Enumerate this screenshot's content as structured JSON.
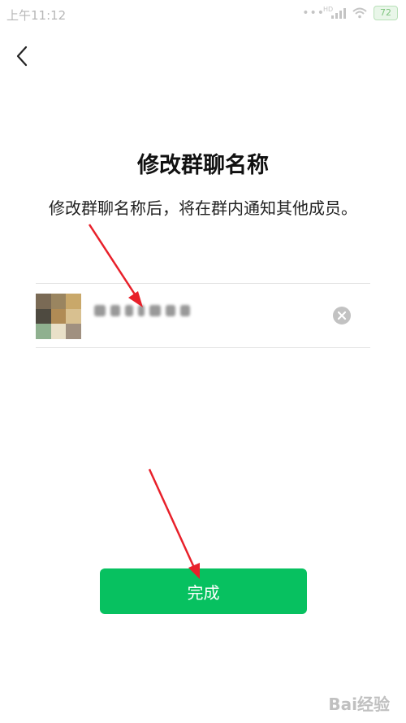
{
  "status_bar": {
    "time": "上午11:12",
    "signal_label": "HD",
    "battery": "72",
    "icons": [
      "dots-icon",
      "signal-icon",
      "wifi-icon",
      "battery-icon"
    ]
  },
  "nav": {
    "back_icon": "chevron-left-icon"
  },
  "header": {
    "title": "修改群聊名称",
    "subtitle": "修改群聊名称后，将在群内通知其他成员。"
  },
  "group_name_field": {
    "avatar_icon": "group-avatar-icon",
    "clear_icon": "clear-circle-icon"
  },
  "actions": {
    "done_label": "完成"
  },
  "colors": {
    "primary_green": "#07c160",
    "annotation_red": "#e8202a"
  },
  "watermark": {
    "text": "Bai经验"
  }
}
